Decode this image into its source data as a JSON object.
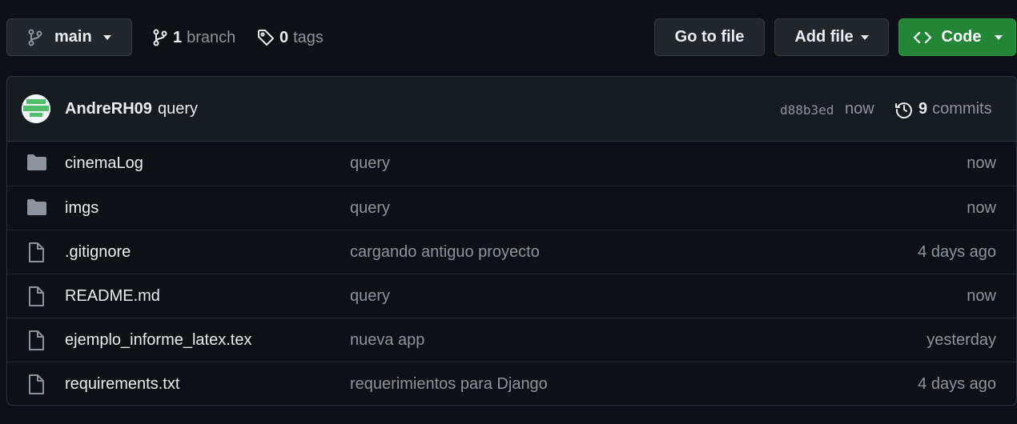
{
  "branch_selector": {
    "label": "main"
  },
  "branches": {
    "count": "1",
    "label": "branch"
  },
  "tags": {
    "count": "0",
    "label": "tags"
  },
  "buttons": {
    "go_to_file": "Go to file",
    "add_file": "Add file",
    "code": "Code",
    "code_color": "#238636"
  },
  "latest_commit": {
    "author": "AndreRH09",
    "message": "query",
    "hash": "d88b3ed",
    "time": "now",
    "commits_count": "9",
    "commits_label": "commits"
  },
  "files": [
    {
      "type": "folder",
      "name": "cinemaLog",
      "message": "query",
      "age": "now"
    },
    {
      "type": "folder",
      "name": "imgs",
      "message": "query",
      "age": "now"
    },
    {
      "type": "file",
      "name": ".gitignore",
      "message": "cargando antiguo proyecto",
      "age": "4 days ago"
    },
    {
      "type": "file",
      "name": "README.md",
      "message": "query",
      "age": "now"
    },
    {
      "type": "file",
      "name": "ejemplo_informe_latex.tex",
      "message": "nueva app",
      "age": "yesterday"
    },
    {
      "type": "file",
      "name": "requirements.txt",
      "message": "requerimientos para Django",
      "age": "4 days ago"
    }
  ]
}
